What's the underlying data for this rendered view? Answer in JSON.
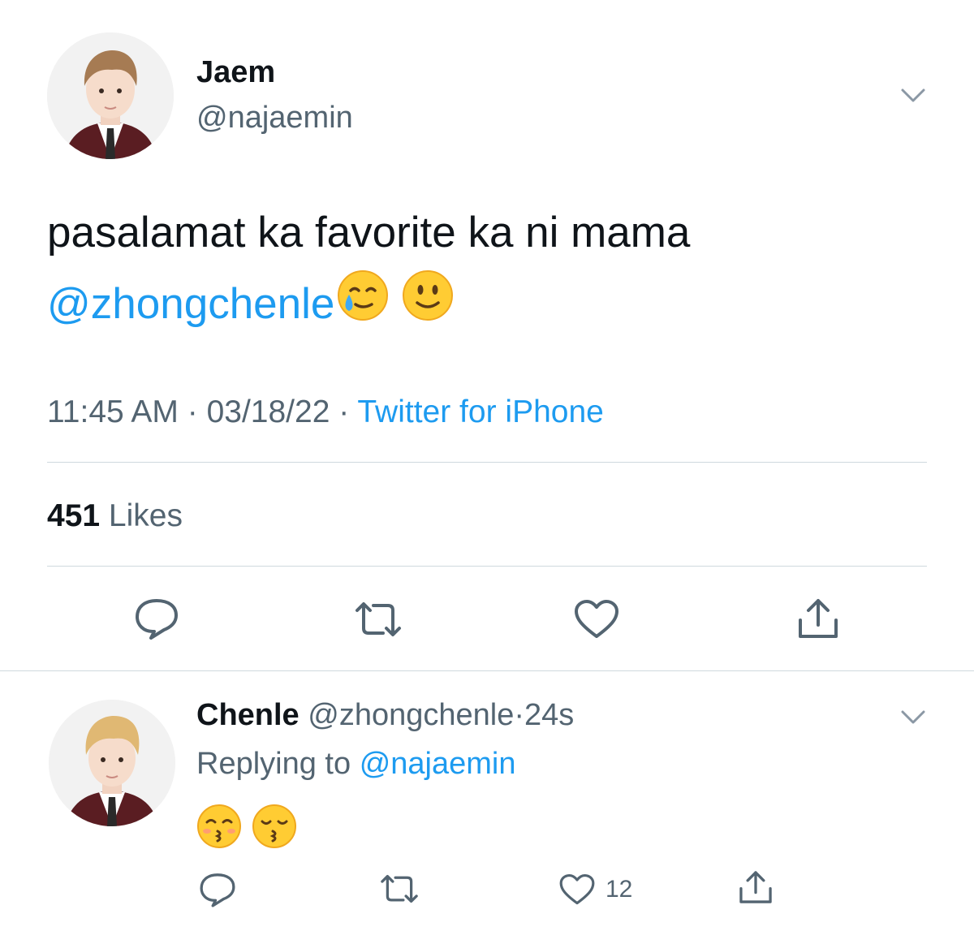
{
  "tweet": {
    "author_name": "Jaem",
    "author_handle": "@najaemin",
    "text": "pasalamat ka favorite ka ni mama",
    "mention": "@zhongchenle",
    "emojis": [
      "smiling-face-with-tear",
      "slightly-smiling-face"
    ],
    "time": "11:45 AM",
    "separator": "·",
    "date": "03/18/22",
    "source": "Twitter for iPhone",
    "likes_count": "451",
    "likes_label": "Likes",
    "actions": [
      "reply-icon",
      "retweet-icon",
      "like-icon",
      "share-icon"
    ]
  },
  "reply": {
    "author_name": "Chenle",
    "author_handle": "@zhongchenle",
    "separator": "·",
    "age": "24s",
    "replying_prefix": "Replying to",
    "replying_to": "@najaemin",
    "emojis": [
      "kissing-face-with-smiling-eyes",
      "kissing-face-with-closed-eyes"
    ],
    "like_count": "12"
  },
  "colors": {
    "text": "#0f1419",
    "secondary": "#536471",
    "link": "#1d9bf0",
    "divider": "#cfd9de"
  }
}
